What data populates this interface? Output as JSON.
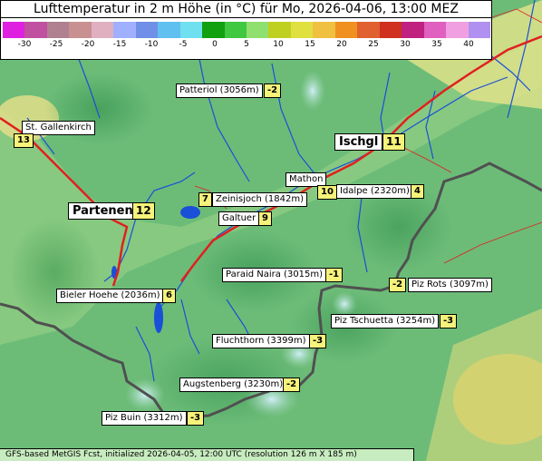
{
  "title": "Lufttemperatur in 2 m Höhe (in °C) für Mo, 2026-04-06, 13:00 MEZ",
  "legend": {
    "ticks": [
      "-30",
      "-25",
      "-20",
      "-15",
      "-10",
      "-5",
      "0",
      "5",
      "10",
      "15",
      "20",
      "25",
      "30",
      "35",
      "40"
    ],
    "colors": [
      "#e020e0",
      "#c050a0",
      "#b08090",
      "#c89090",
      "#e0b0c0",
      "#a0b0ff",
      "#7090e8",
      "#60c0f0",
      "#70e0f0",
      "#10a010",
      "#40c840",
      "#90e070",
      "#c0d020",
      "#e0e040",
      "#f0c040",
      "#f09020",
      "#e06030",
      "#d03020",
      "#c02080",
      "#e060c0",
      "#f0a0e0",
      "#b090f0"
    ]
  },
  "locations": [
    {
      "name": "Patteriol (3056m)",
      "value": "-2"
    },
    {
      "name": "St. Gallenkirch",
      "value": "13"
    },
    {
      "name": "Ischgl",
      "value": "11"
    },
    {
      "name": "Mathon",
      "value": "10"
    },
    {
      "name": "Idalpe (2320m)",
      "value": "4"
    },
    {
      "name": "Zeinisjoch (1842m)",
      "value": "7"
    },
    {
      "name": "Partenen",
      "value": "12"
    },
    {
      "name": "Galtuer",
      "value": "9"
    },
    {
      "name": "Paraid Naira (3015m)",
      "value": "-1"
    },
    {
      "name": "Piz Rots (3097m)",
      "value": "-2"
    },
    {
      "name": "Bieler Hoehe (2036m)",
      "value": "6"
    },
    {
      "name": "Piz Tschuetta (3254m)",
      "value": "-3"
    },
    {
      "name": "Fluchthorn (3399m)",
      "value": "-3"
    },
    {
      "name": "Augstenberg (3230m)",
      "value": "-2"
    },
    {
      "name": "Piz Buin (3312m)",
      "value": "-3"
    }
  ],
  "footer": "GFS-based MetGIS Fcst, initialized 2026-04-05, 12:00 UTC (resolution 126 m X 185 m)"
}
